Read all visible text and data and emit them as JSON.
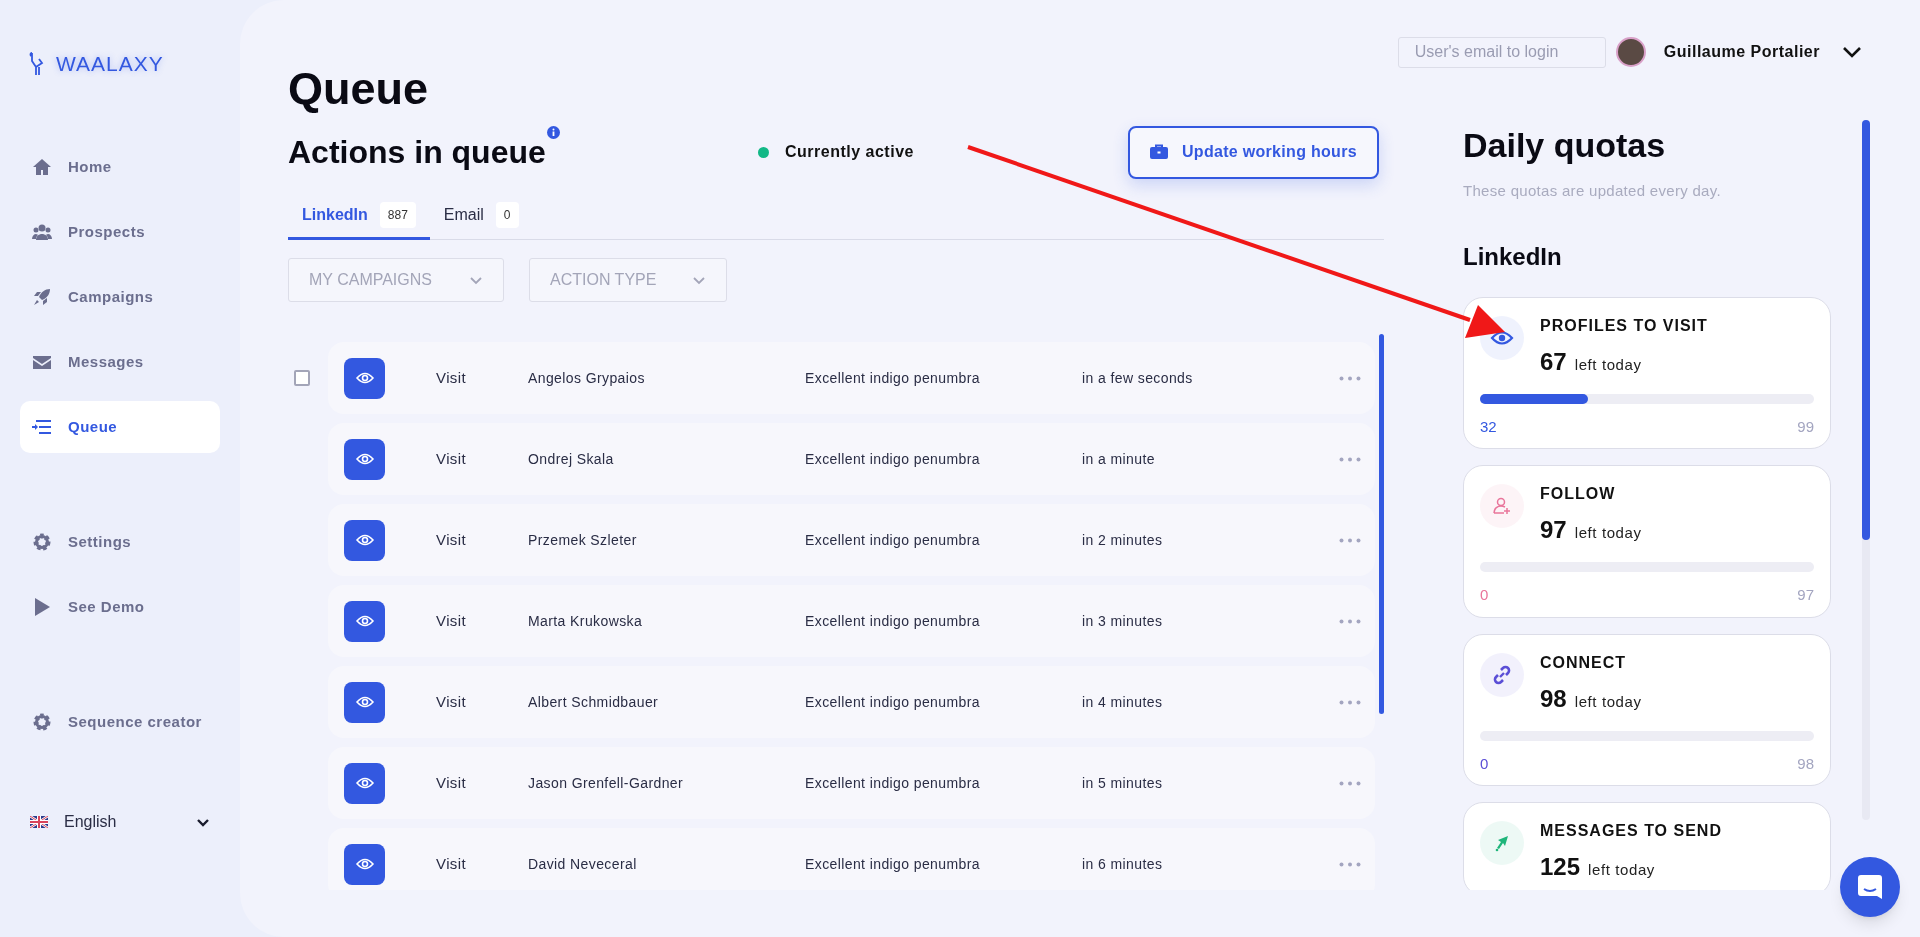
{
  "brand": {
    "name": "WAALAXY"
  },
  "sidebar": {
    "groups": [
      {
        "items": [
          {
            "label": "Home",
            "selected": false
          },
          {
            "label": "Prospects",
            "selected": false
          },
          {
            "label": "Campaigns",
            "selected": false
          },
          {
            "label": "Messages",
            "selected": false
          },
          {
            "label": "Queue",
            "selected": true
          }
        ]
      },
      {
        "items": [
          {
            "label": "Settings",
            "selected": false
          },
          {
            "label": "See Demo",
            "selected": false
          }
        ]
      },
      {
        "items": [
          {
            "label": "Sequence creator",
            "selected": false
          }
        ]
      }
    ],
    "language": "English"
  },
  "header": {
    "email_field": {
      "placeholder": "User's email to login"
    },
    "user_name": "Guillaume Portalier"
  },
  "page_title": "Queue",
  "section_title": "Actions in queue",
  "status": {
    "label": "Currently active",
    "active": true
  },
  "update_button": "Update working hours",
  "tabs": [
    {
      "label": "LinkedIn",
      "count": "887",
      "selected": true
    },
    {
      "label": "Email",
      "count": "0",
      "selected": false
    }
  ],
  "filters": [
    {
      "label": "MY CAMPAIGNS"
    },
    {
      "label": "ACTION TYPE"
    }
  ],
  "select_checkbox": {
    "checked": false
  },
  "rows": [
    {
      "action": "Visit",
      "name": "Angelos Grypaios",
      "campaign": "Excellent indigo penumbra",
      "time": "in a few seconds"
    },
    {
      "action": "Visit",
      "name": "Ondrej Skala",
      "campaign": "Excellent indigo penumbra",
      "time": "in a minute"
    },
    {
      "action": "Visit",
      "name": "Przemek Szleter",
      "campaign": "Excellent indigo penumbra",
      "time": "in 2 minutes"
    },
    {
      "action": "Visit",
      "name": "Marta Krukowska",
      "campaign": "Excellent indigo penumbra",
      "time": "in 3 minutes"
    },
    {
      "action": "Visit",
      "name": "Albert Schmidbauer",
      "campaign": "Excellent indigo penumbra",
      "time": "in 4 minutes"
    },
    {
      "action": "Visit",
      "name": "Jason Grenfell-Gardner",
      "campaign": "Excellent indigo penumbra",
      "time": "in 5 minutes"
    },
    {
      "action": "Visit",
      "name": "David Neveceral",
      "campaign": "Excellent indigo penumbra",
      "time": "in 6 minutes"
    }
  ],
  "quotas": {
    "title": "Daily quotas",
    "subtitle": "These quotas are updated every day.",
    "section": "LinkedIn",
    "cards": [
      {
        "title": "PROFILES TO VISIT",
        "count": "67",
        "suffix": "left today",
        "level": 0.323,
        "start": "32",
        "end": "99",
        "color": "#3358e0"
      },
      {
        "title": "FOLLOW",
        "count": "97",
        "suffix": "left today",
        "level": 0,
        "start": "0",
        "end": "97",
        "color": "#e9759b"
      },
      {
        "title": "CONNECT",
        "count": "98",
        "suffix": "left today",
        "level": 0,
        "start": "0",
        "end": "98",
        "color": "#5b4fd6"
      },
      {
        "title": "MESSAGES TO SEND",
        "count": "125",
        "suffix": "left today",
        "color": "#1fb57a"
      }
    ]
  }
}
